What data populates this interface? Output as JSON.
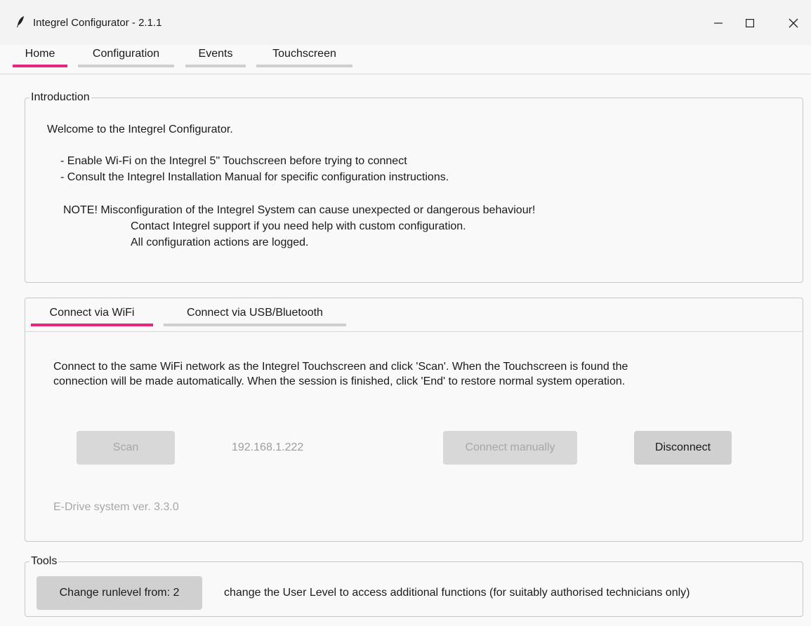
{
  "window": {
    "title": "Integrel Configurator - 2.1.1",
    "icon": "feather-icon"
  },
  "tabs": [
    {
      "label": "Home",
      "active": true
    },
    {
      "label": "Configuration",
      "active": false
    },
    {
      "label": "Events",
      "active": false
    },
    {
      "label": "Touchscreen",
      "active": false
    }
  ],
  "intro": {
    "legend": "Introduction",
    "welcome": "Welcome to the Integrel Configurator.",
    "bullet1": "- Enable Wi-Fi on the Integrel 5\" Touchscreen before trying to connect",
    "bullet2": "- Consult the Integrel Installation Manual for specific configuration instructions.",
    "note1": "NOTE!  Misconfiguration of the Integrel System can cause unexpected or dangerous behaviour!",
    "note2": "Contact Integrel support if you need help with custom configuration.",
    "note3": "All configuration actions are logged."
  },
  "connect": {
    "tabs": [
      {
        "label": "Connect via WiFi",
        "active": true
      },
      {
        "label": "Connect via USB/Bluetooth",
        "active": false
      }
    ],
    "description": "Connect to the same WiFi network as the Integrel Touchscreen and click 'Scan'. When the Touchscreen is found the connection will be made automatically. When the session is finished, click 'End' to restore normal system operation.",
    "scan_label": "Scan",
    "ip": "192.168.1.222",
    "connect_manually_label": "Connect manually",
    "disconnect_label": "Disconnect",
    "edrive": "E-Drive system ver. 3.3.0"
  },
  "tools": {
    "legend": "Tools",
    "runlevel_label": "Change runlevel from: 2",
    "description": "change the User Level to access additional functions (for suitably authorised technicians only)"
  },
  "colors": {
    "accent": "#e6267d",
    "inactive_tab": "#cfcfcf",
    "button": "#d0d0d0"
  }
}
